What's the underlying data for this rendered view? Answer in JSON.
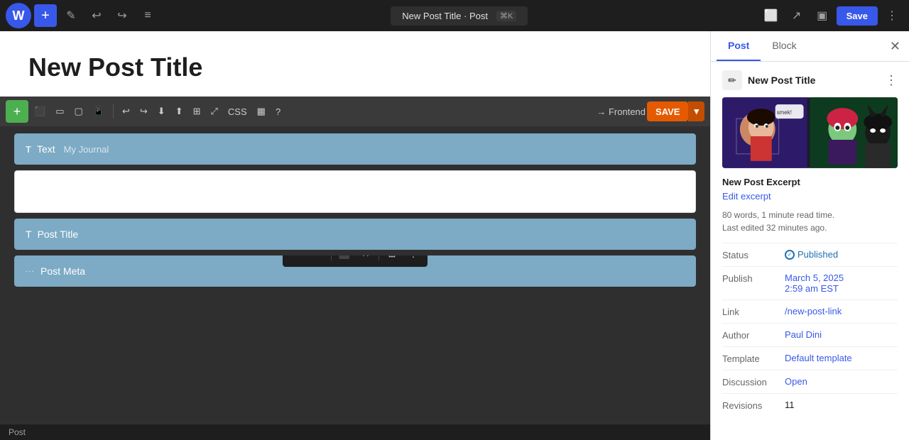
{
  "topbar": {
    "title": "New Post Title",
    "title_separator": "·",
    "title_type": "Post",
    "shortcut": "⌘K",
    "save_label": "Save"
  },
  "divi_toolbar": {
    "add_label": "+",
    "frontend_label": "→ Frontend",
    "save_label": "SAVE",
    "css_label": "CSS",
    "tooltip_label": "?"
  },
  "editor": {
    "post_title": "New Post Title",
    "blocks": [
      {
        "type": "text",
        "icon": "T",
        "label": "Text",
        "sub": "My Journal"
      },
      {
        "type": "empty",
        "label": ""
      },
      {
        "type": "post_title",
        "icon": "T",
        "label": "Post Title",
        "sub": ""
      },
      {
        "type": "post_meta",
        "icon": "···",
        "label": "Post Meta",
        "sub": ""
      }
    ]
  },
  "floating_toolbar": {
    "buttons": [
      "✏️",
      "✒",
      "⬛",
      "✕",
      "⊞",
      "⋮"
    ]
  },
  "status_bar": {
    "label": "Post"
  },
  "right_panel": {
    "tabs": [
      "Post",
      "Block"
    ],
    "active_tab": "Post",
    "post_info": {
      "icon": "✏",
      "title": "New Post Title",
      "excerpt_label": "New Post Excerpt",
      "edit_excerpt_label": "Edit excerpt",
      "word_count": "80 words, 1 minute read time.",
      "last_edited": "Last edited 32 minutes ago.",
      "status_label": "Status",
      "status_value": "Published",
      "publish_label": "Publish",
      "publish_date": "March 5, 2025",
      "publish_time": "2:59 am EST",
      "link_label": "Link",
      "link_value": "/new-post-link",
      "author_label": "Author",
      "author_value": "Paul Dini",
      "template_label": "Template",
      "template_value": "Default template",
      "discussion_label": "Discussion",
      "discussion_value": "Open",
      "revisions_label": "Revisions",
      "revisions_value": "11"
    }
  }
}
